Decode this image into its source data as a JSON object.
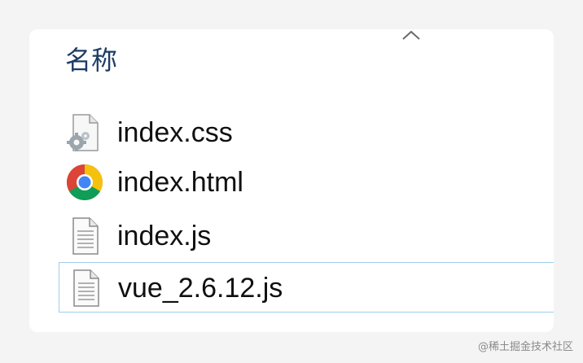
{
  "list_header": {
    "column_name": "名称"
  },
  "files": [
    {
      "name": "index.css",
      "icon": "css-settings-file-icon"
    },
    {
      "name": "index.html",
      "icon": "chrome-icon"
    },
    {
      "name": "index.js",
      "icon": "text-file-icon"
    },
    {
      "name": "vue_2.6.12.js",
      "icon": "text-file-icon",
      "selected": true
    }
  ],
  "watermark": "@稀土掘金技术社区",
  "colors": {
    "header_text": "#1e3c64",
    "selection_border": "#9fd0ea",
    "chrome_red": "#db4437",
    "chrome_yellow": "#f4c20d",
    "chrome_green": "#0f9d58",
    "chrome_blue": "#4285f4"
  }
}
